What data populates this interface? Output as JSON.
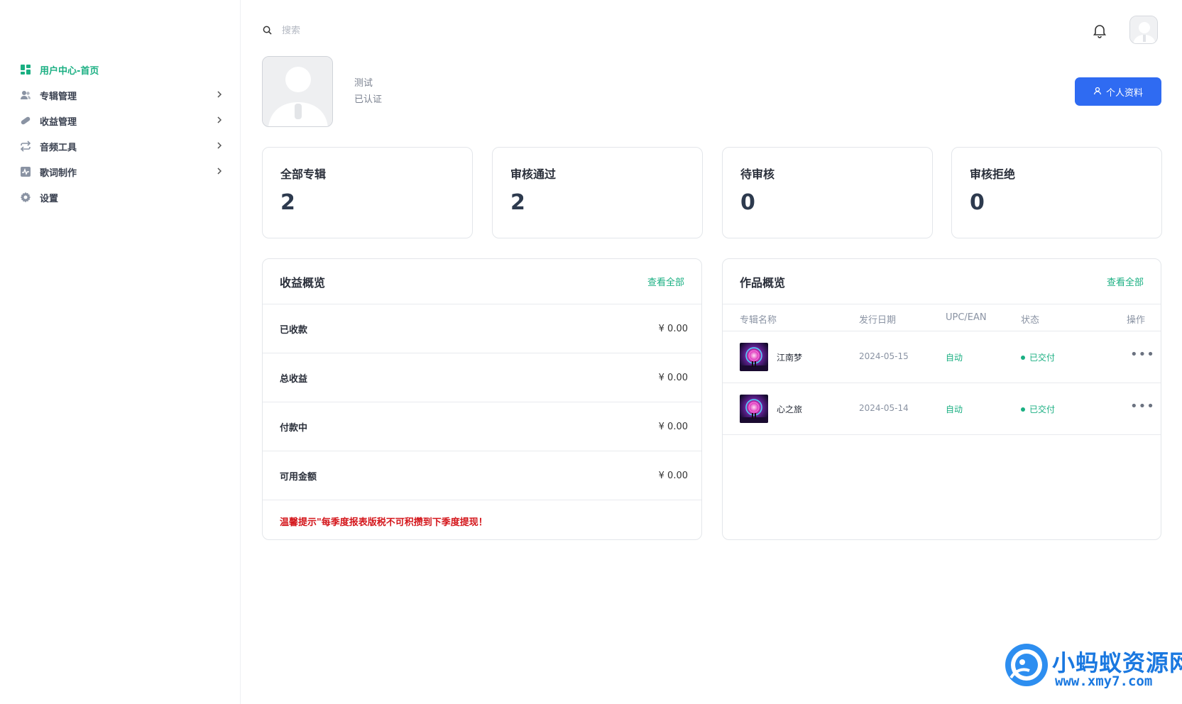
{
  "sidebar": {
    "items": [
      {
        "label": "用户中心-首页",
        "icon": "dashboard-icon",
        "active": true
      },
      {
        "label": "专辑管理",
        "icon": "users-icon",
        "has_children": true
      },
      {
        "label": "收益管理",
        "icon": "pill-icon",
        "has_children": true
      },
      {
        "label": "音频工具",
        "icon": "repeat-icon",
        "has_children": true
      },
      {
        "label": "歌词制作",
        "icon": "activity-icon",
        "has_children": true
      },
      {
        "label": "设置",
        "icon": "gear-icon",
        "has_children": false
      }
    ]
  },
  "search": {
    "placeholder": "搜索"
  },
  "profile": {
    "name": "测试",
    "status": "已认证",
    "button_label": "个人资料"
  },
  "stats": [
    {
      "title": "全部专辑",
      "value": "2"
    },
    {
      "title": "审核通过",
      "value": "2"
    },
    {
      "title": "待审核",
      "value": "0"
    },
    {
      "title": "审核拒绝",
      "value": "0"
    }
  ],
  "earnings": {
    "title": "收益概览",
    "link": "查看全部",
    "rows": [
      {
        "label": "已收款",
        "value": "¥ 0.00"
      },
      {
        "label": "总收益",
        "value": "¥ 0.00"
      },
      {
        "label": "付款中",
        "value": "¥ 0.00"
      },
      {
        "label": "可用金额",
        "value": "¥ 0.00"
      }
    ],
    "tip": "温馨提示\"每季度报表版税不可积攒到下季度提现！"
  },
  "works": {
    "title": "作品概览",
    "link": "查看全部",
    "columns": [
      "专辑名称",
      "发行日期",
      "UPC/EAN",
      "状态",
      "操作"
    ],
    "rows": [
      {
        "name": "江南梦",
        "date": "2024-05-15",
        "upc": "自动",
        "status": "已交付"
      },
      {
        "name": "心之旅",
        "date": "2024-05-14",
        "upc": "自动",
        "status": "已交付"
      }
    ],
    "more": "•••"
  },
  "watermark": {
    "title": "小蚂蚁资源网",
    "url": "www.xmy7.com"
  },
  "colors": {
    "accent": "#1aaf82",
    "primary_button": "#2f6bf2",
    "warning": "#d4161b"
  }
}
